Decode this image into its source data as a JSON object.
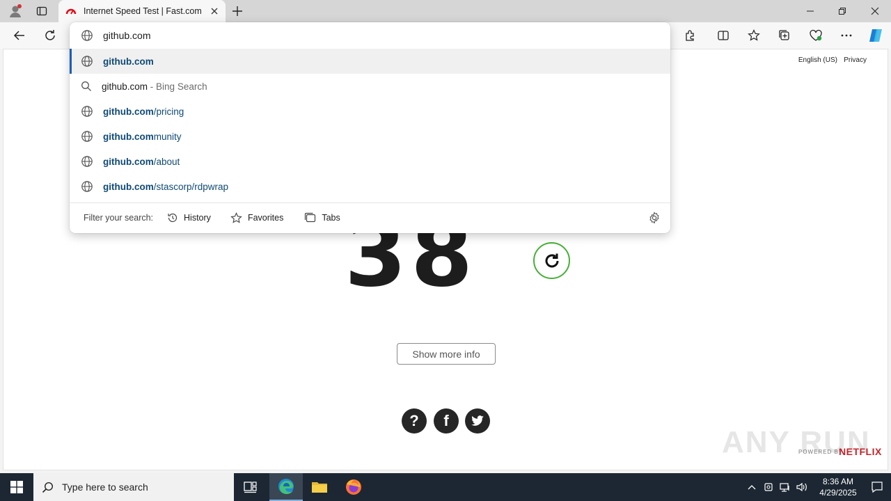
{
  "tab": {
    "title": "Internet Speed Test | Fast.com"
  },
  "omnibox": {
    "value": "github.com",
    "suggestions": [
      {
        "bold": "github.com",
        "rest": ""
      },
      {
        "plain": "github.com",
        "muted": " - Bing Search"
      },
      {
        "bold": "github.com",
        "rest": "/pricing"
      },
      {
        "bold": "github.com",
        "rest": "munity"
      },
      {
        "bold": "github.com",
        "rest": "/about"
      },
      {
        "bold": "github.com",
        "rest": "/stascorp/rdpwrap"
      }
    ],
    "filter_label": "Filter your search:",
    "filters": [
      "History",
      "Favorites",
      "Tabs"
    ]
  },
  "page": {
    "lang": "English (US)",
    "privacy": "Privacy",
    "speed_digits": "38",
    "more_info": "Show more info",
    "social": [
      "?",
      "f",
      "t"
    ],
    "watermark": "ANY RUN",
    "powered_by": "POWERED BY",
    "netflix": "NETFLIX"
  },
  "taskbar": {
    "search_placeholder": "Type here to search",
    "time": "8:36 AM",
    "date": "4/29/2025"
  },
  "colors": {
    "accent": "#45b035",
    "link": "#0f4a75",
    "netflix": "#c6232a",
    "taskbar": "#1c2733"
  }
}
